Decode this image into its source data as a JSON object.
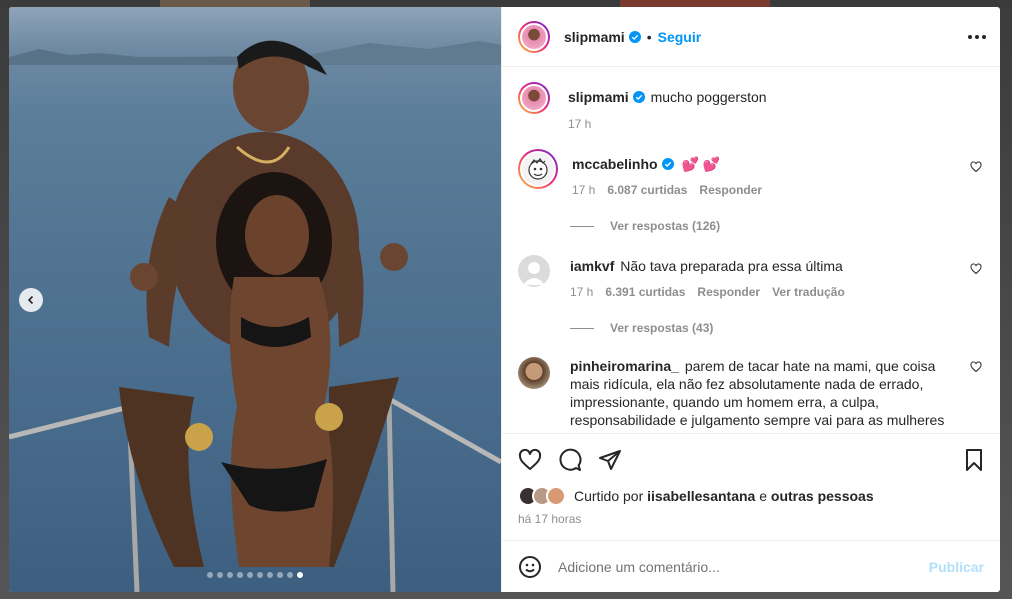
{
  "post": {
    "author": "slipmami",
    "follow_label": "Seguir",
    "separator": "•",
    "caption_text": "mucho poggerston",
    "caption_time": "17 h"
  },
  "carousel": {
    "dot_count": 10,
    "active_index": 9
  },
  "comments": [
    {
      "username": "mccabelinho",
      "verified": true,
      "text": "💕 💕",
      "time": "17 h",
      "likes": "6.087 curtidas",
      "reply_label": "Responder",
      "replies_label": "Ver respostas (126)"
    },
    {
      "username": "iamkvf",
      "verified": false,
      "text": "Não tava preparada pra essa última",
      "time": "17 h",
      "likes": "6.391 curtidas",
      "reply_label": "Responder",
      "translate_label": "Ver tradução",
      "replies_label": "Ver respostas (43)"
    },
    {
      "username": "pinheiromarina_",
      "verified": false,
      "text": "parem de tacar hate na mami, que coisa mais ridícula, ela não fez absolutamente nada de errado, impressionante, quando um homem erra, a culpa, responsabilidade e julgamento sempre vai para as mulheres né? nunca pra o jurandir"
    }
  ],
  "likes_bar": {
    "prefix": "Curtido por",
    "user": "iisabellesantana",
    "conjunction": "e",
    "others": "outras pessoas",
    "time": "há 17 horas"
  },
  "composer": {
    "placeholder": "Adicione um comentário...",
    "publish_label": "Publicar"
  },
  "icons": {
    "more": "more-options-icon",
    "like": "heart-icon",
    "comment": "comment-icon",
    "share": "share-icon",
    "save": "bookmark-icon",
    "emoji": "emoji-icon",
    "prev": "chevron-left-icon",
    "verified": "verified-badge-icon"
  },
  "colors": {
    "accent": "#0095f6",
    "verified": "#0095f6",
    "publish_disabled": "#b2dffc",
    "secondary_text": "#8e8e8e"
  }
}
